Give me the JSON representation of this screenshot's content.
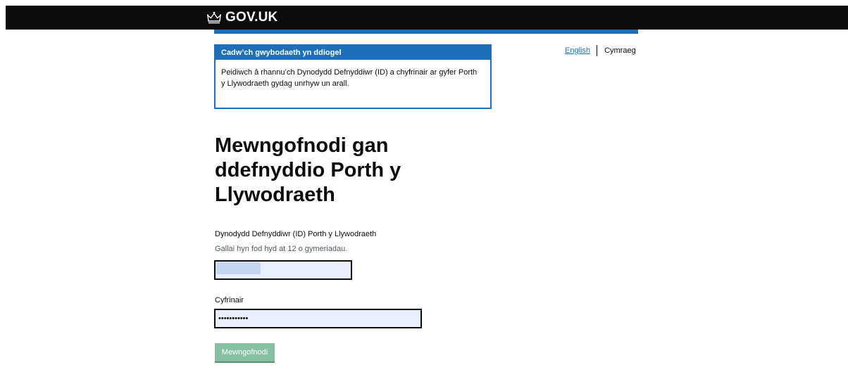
{
  "header": {
    "logo_text": "GOV.UK",
    "logo_icon": "crown-icon"
  },
  "notice": {
    "title": "Cadw’ch gwybodaeth yn ddiogel",
    "body": "Peidiwch â rhannu’ch Dynodydd Defnyddiwr (ID) a chyfrinair ar gyfer Porth y Llywodraeth gydag unrhyw un arall."
  },
  "language": {
    "english": "English",
    "welsh": "Cymraeg"
  },
  "page": {
    "title": "Mewngofnodi gan ddefnyddio Porth y Llywodraeth"
  },
  "form": {
    "user_id_label": "Dynodydd Defnyddiwr (ID) Porth y Llywodraeth",
    "user_id_hint": "Gallai hyn fod hyd at 12 o gymeriadau.",
    "user_id_value": "",
    "password_label": "Cyfrinair",
    "password_value": "•••••••••••",
    "submit_label": "Mewngofnodi"
  },
  "colors": {
    "header_bg": "#0b0c0c",
    "brand_blue": "#1d70b8",
    "input_autofill_bg": "#e8f0fe",
    "button_disabled_green": "#85c1a0"
  }
}
